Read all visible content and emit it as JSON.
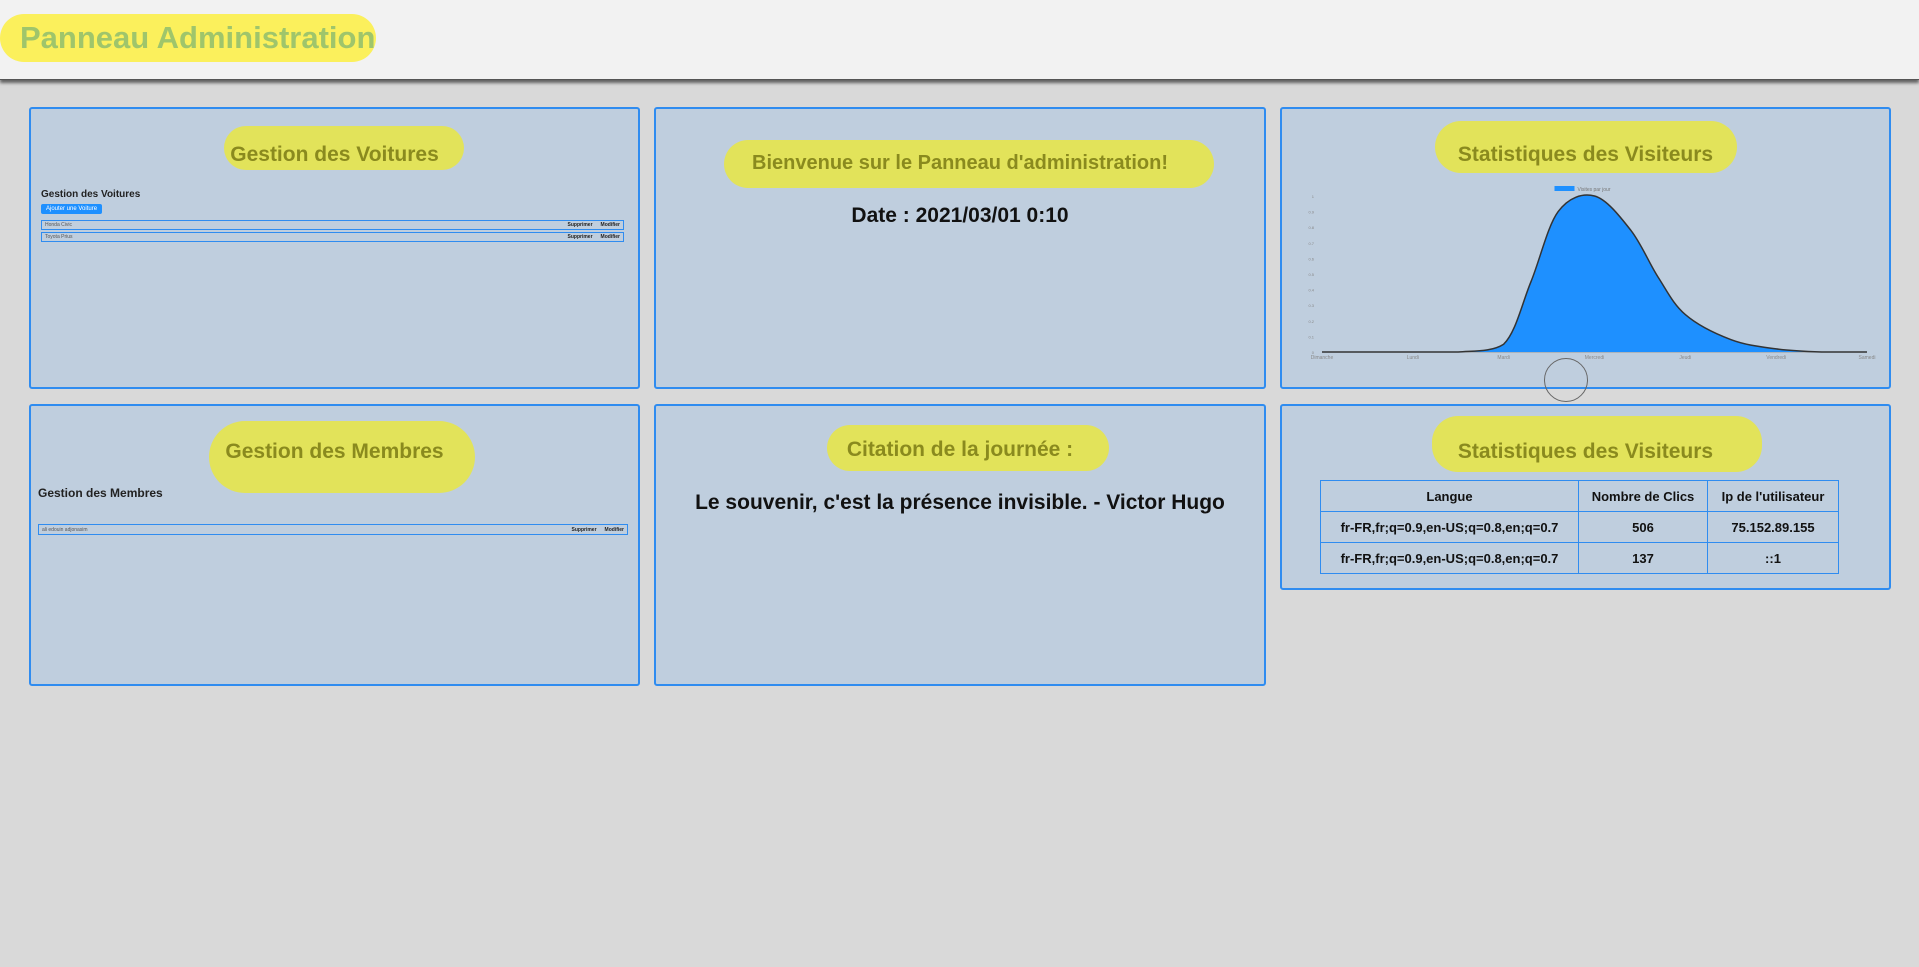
{
  "header": {
    "title": "Panneau Administration"
  },
  "cards": {
    "voitures": {
      "title": "Gestion des Voitures",
      "inner_title": "Gestion des Voitures",
      "add_button": "Ajouter une Voiture",
      "rows": [
        {
          "name": "Honda Civic",
          "delete": "Supprimer",
          "edit": "Modifier"
        },
        {
          "name": "Toyota Prius",
          "delete": "Supprimer",
          "edit": "Modifier"
        }
      ]
    },
    "welcome": {
      "title": "Bienvenue sur le Panneau d'administration!",
      "date": "Date : 2021/03/01 0:10"
    },
    "visitors_chart": {
      "title": "Statistiques des Visiteurs"
    },
    "membres": {
      "title": "Gestion des Membres",
      "inner_title": "Gestion des Membres",
      "rows": [
        {
          "name": "ali edouin adjonasim",
          "delete": "Supprimer",
          "edit": "Modifier"
        }
      ]
    },
    "quote": {
      "title": "Citation de la journée :",
      "text": "Le souvenir, c'est la présence invisible. - Victor Hugo"
    },
    "visitors_table": {
      "title": "Statistiques des Visiteurs",
      "headers": [
        "Langue",
        "Nombre de Clics",
        "Ip de l'utilisateur"
      ],
      "rows": [
        [
          "fr-FR,fr;q=0.9,en-US;q=0.8,en;q=0.7",
          "506",
          "75.152.89.155"
        ],
        [
          "fr-FR,fr;q=0.9,en-US;q=0.8,en;q=0.7",
          "137",
          "::1"
        ]
      ]
    }
  },
  "chart_data": {
    "type": "area",
    "series": [
      {
        "name": "Visites par jour",
        "color": "#1e90ff"
      }
    ],
    "categories": [
      "Dimanche",
      "Lundi",
      "Mardi",
      "Mercredi",
      "Jeudi",
      "Vendredi",
      "Samedi"
    ],
    "x": [
      0,
      0.5,
      1,
      1.5,
      2,
      2.3,
      2.6,
      3,
      3.4,
      3.7,
      4,
      4.5,
      5,
      5.5,
      6
    ],
    "values": [
      0,
      0,
      0,
      0,
      0.05,
      0.45,
      0.9,
      1.0,
      0.78,
      0.48,
      0.24,
      0.08,
      0.02,
      0,
      0
    ],
    "ylim": [
      0,
      1
    ],
    "y_ticks": [
      "0",
      "0.1",
      "0.2",
      "0.3",
      "0.4",
      "0.5",
      "0.6",
      "0.7",
      "0.8",
      "0.9",
      "1"
    ],
    "legend": "top-center",
    "grid": false
  }
}
